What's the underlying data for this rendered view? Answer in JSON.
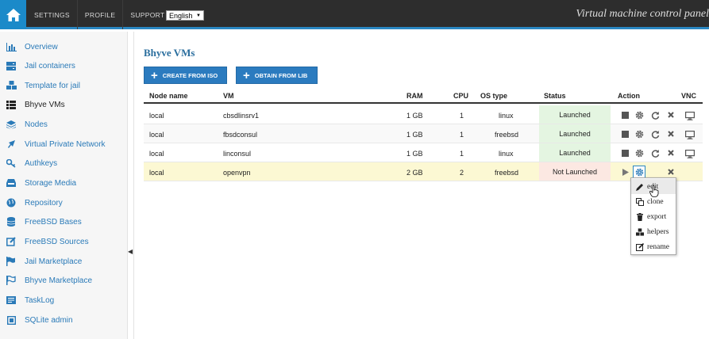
{
  "topbar": {
    "nav": [
      "SETTINGS",
      "PROFILE",
      "SUPPORT"
    ],
    "language": "English",
    "panel_title": "Virtual machine control panel"
  },
  "sidebar": {
    "items": [
      {
        "label": "Overview",
        "icon": "bar-chart-icon"
      },
      {
        "label": "Jail containers",
        "icon": "server-icon"
      },
      {
        "label": "Template for jail",
        "icon": "cubes-icon"
      },
      {
        "label": "Bhyve VMs",
        "icon": "list-icon"
      },
      {
        "label": "Nodes",
        "icon": "stack-icon"
      },
      {
        "label": "Virtual Private Network",
        "icon": "plane-icon"
      },
      {
        "label": "Authkeys",
        "icon": "key-icon"
      },
      {
        "label": "Storage Media",
        "icon": "inbox-icon"
      },
      {
        "label": "Repository",
        "icon": "globe-icon"
      },
      {
        "label": "FreeBSD Bases",
        "icon": "database-icon"
      },
      {
        "label": "FreeBSD Sources",
        "icon": "edit-icon"
      },
      {
        "label": "Jail Marketplace",
        "icon": "flag-icon"
      },
      {
        "label": "Bhyve Marketplace",
        "icon": "flag-outline-icon"
      },
      {
        "label": "TaskLog",
        "icon": "log-icon"
      },
      {
        "label": "SQLite admin",
        "icon": "sqlite-icon"
      }
    ],
    "active": "Bhyve VMs"
  },
  "main": {
    "title": "Bhyve VMs",
    "buttons": {
      "create_from_iso": "CREATE FROM ISO",
      "obtain_from_lib": "OBTAIN FROM LIB"
    },
    "table": {
      "headers": {
        "node": "Node name",
        "vm": "VM",
        "ram": "RAM",
        "cpu": "CPU",
        "os": "OS type",
        "status": "Status",
        "action": "Action",
        "vnc": "VNC"
      },
      "rows": [
        {
          "node": "local",
          "vm": "cbsdlinsrv1",
          "ram": "1 GB",
          "cpu": "1",
          "os": "linux",
          "status": "Launched"
        },
        {
          "node": "local",
          "vm": "fbsdconsul",
          "ram": "1 GB",
          "cpu": "1",
          "os": "freebsd",
          "status": "Launched"
        },
        {
          "node": "local",
          "vm": "linconsul",
          "ram": "1 GB",
          "cpu": "1",
          "os": "linux",
          "status": "Launched"
        },
        {
          "node": "local",
          "vm": "openvpn",
          "ram": "2 GB",
          "cpu": "2",
          "os": "freebsd",
          "status": "Not Launched"
        }
      ]
    },
    "context_menu": {
      "items": [
        {
          "label": "edit",
          "icon": "pencil-icon"
        },
        {
          "label": "clone",
          "icon": "copy-icon"
        },
        {
          "label": "export",
          "icon": "trash-icon"
        },
        {
          "label": "helpers",
          "icon": "cubes-icon"
        },
        {
          "label": "rename",
          "icon": "edit-icon"
        }
      ]
    }
  },
  "colors": {
    "accent": "#2b7bbf",
    "topbar": "#2d2d2d",
    "launched_bg": "#e4f5e1",
    "stopped_bg": "#fce8e2",
    "selected_row": "#fcf8d3"
  }
}
